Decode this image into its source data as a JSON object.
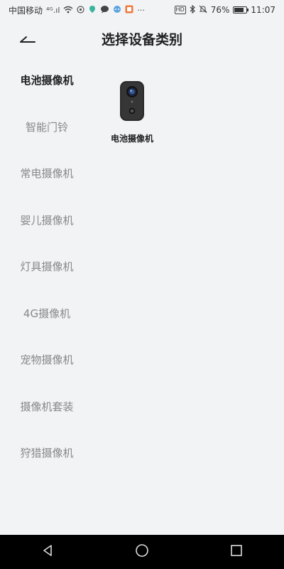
{
  "status_bar": {
    "carrier": "中国移动",
    "signal": "⁴ᴳ.ıl",
    "icons": [
      "wifi-icon",
      "location-icon",
      "wechat-icon",
      "app-icon",
      "notification-icon",
      "more-icon"
    ],
    "more": "···",
    "hd": "HD",
    "battery_percent": "76%",
    "battery_level": 0.76,
    "time": "11:07"
  },
  "header": {
    "title": "选择设备类别"
  },
  "categories": [
    {
      "label": "电池摄像机",
      "selected": true
    },
    {
      "label": "智能门铃",
      "selected": false
    },
    {
      "label": "常电摄像机",
      "selected": false
    },
    {
      "label": "婴儿摄像机",
      "selected": false
    },
    {
      "label": "灯具摄像机",
      "selected": false
    },
    {
      "label": "4G摄像机",
      "selected": false
    },
    {
      "label": "宠物摄像机",
      "selected": false
    },
    {
      "label": "摄像机套装",
      "selected": false
    },
    {
      "label": "狩猎摄像机",
      "selected": false
    }
  ],
  "devices": [
    {
      "label": "电池摄像机",
      "icon": "battery-camera-icon"
    }
  ]
}
